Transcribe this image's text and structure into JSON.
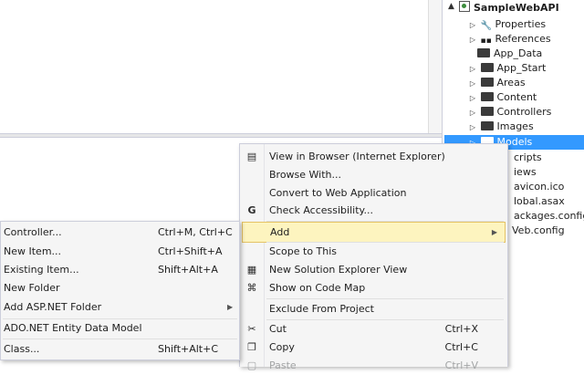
{
  "solution_explorer": {
    "project": "SampleWebAPI",
    "items": [
      {
        "label": "Properties",
        "expandable": true,
        "icon": "wrench-icon"
      },
      {
        "label": "References",
        "expandable": true,
        "icon": "references-icon"
      },
      {
        "label": "App_Data",
        "expandable": false,
        "icon": "folder-icon"
      },
      {
        "label": "App_Start",
        "expandable": true,
        "icon": "folder-icon"
      },
      {
        "label": "Areas",
        "expandable": true,
        "icon": "folder-icon"
      },
      {
        "label": "Content",
        "expandable": true,
        "icon": "folder-icon"
      },
      {
        "label": "Controllers",
        "expandable": true,
        "icon": "folder-icon"
      },
      {
        "label": "Images",
        "expandable": true,
        "icon": "folder-icon"
      },
      {
        "label": "Models",
        "expandable": true,
        "icon": "folder-icon",
        "selected": true
      },
      {
        "label": "cripts",
        "icon": "folder-icon"
      },
      {
        "label": "iews",
        "icon": "folder-icon"
      },
      {
        "label": "avicon.ico",
        "icon": "file-icon"
      },
      {
        "label": "lobal.asax",
        "icon": "file-icon"
      },
      {
        "label": "ackages.config",
        "icon": "file-icon"
      },
      {
        "label": "Veb.config",
        "icon": "file-icon"
      }
    ]
  },
  "context_menu": {
    "items": [
      {
        "label": "View in Browser (Internet Explorer)",
        "icon": "browser-icon"
      },
      {
        "label": "Browse With..."
      },
      {
        "label": "Convert to Web Application"
      },
      {
        "label": "Check Accessibility...",
        "icon": "accessibility-icon"
      },
      {
        "label": "Add",
        "submenu": true,
        "highlighted": true
      },
      {
        "label": "Scope to This"
      },
      {
        "label": "New Solution Explorer View",
        "icon": "new-view-icon"
      },
      {
        "label": "Show on Code Map",
        "icon": "code-map-icon"
      },
      {
        "label": "Exclude From Project"
      },
      {
        "label": "Cut",
        "shortcut": "Ctrl+X",
        "icon": "scissors-icon"
      },
      {
        "label": "Copy",
        "shortcut": "Ctrl+C",
        "icon": "copy-icon"
      },
      {
        "label": "Paste",
        "shortcut": "Ctrl+V",
        "icon": "paste-icon",
        "disabled": true
      }
    ]
  },
  "add_submenu": {
    "items": [
      {
        "label": "Controller...",
        "shortcut": "Ctrl+M, Ctrl+C"
      },
      {
        "label": "New Item...",
        "shortcut": "Ctrl+Shift+A"
      },
      {
        "label": "Existing Item...",
        "shortcut": "Shift+Alt+A"
      },
      {
        "label": "New Folder"
      },
      {
        "label": "Add ASP.NET Folder",
        "submenu": true
      },
      {
        "label": "ADO.NET Entity Data Model"
      },
      {
        "label": "Class...",
        "shortcut": "Shift+Alt+C"
      }
    ]
  },
  "colors": {
    "selection": "#3399ff",
    "menu_bg": "#f5f5f5",
    "menu_highlight": "#fdf4bf"
  }
}
